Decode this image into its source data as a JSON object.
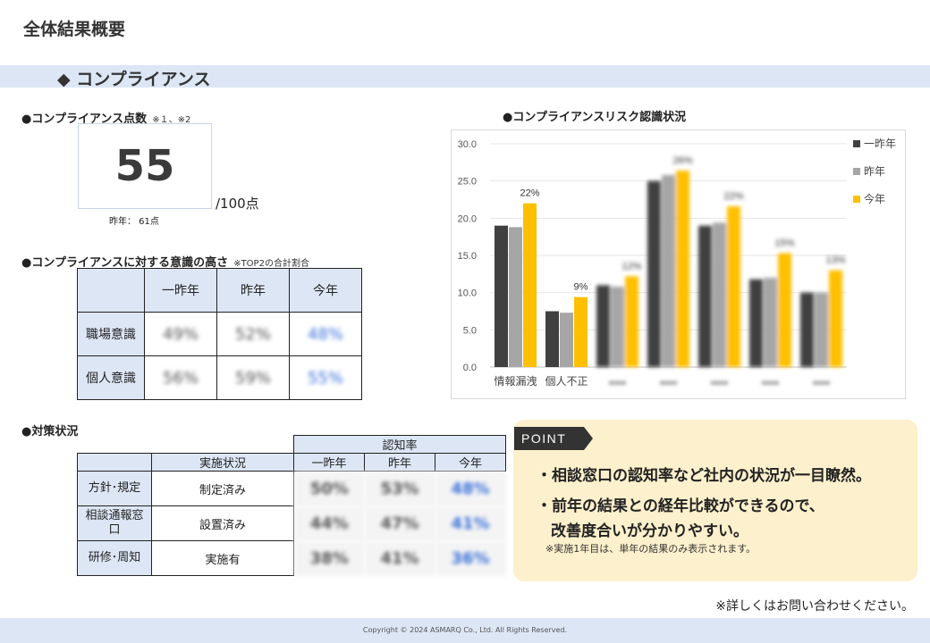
{
  "page": {
    "title": "全体結果概要",
    "section_title": "◆  コンプライアンス"
  },
  "score": {
    "heading": "●コンプライアンス点数",
    "note": "※１、※2",
    "value": "55",
    "unit": "/100点",
    "previous": "昨年：  61点"
  },
  "awareness": {
    "heading": "●コンプライアンスに対する意識の高さ",
    "note": "※TOP2の合計割合",
    "columns": [
      "一昨年",
      "昨年",
      "今年"
    ],
    "rows": [
      {
        "label": "職場意識",
        "values": [
          "49%",
          "52%",
          "48%"
        ]
      },
      {
        "label": "個人意識",
        "values": [
          "56%",
          "59%",
          "55%"
        ]
      }
    ]
  },
  "measures": {
    "heading": "●対策状況",
    "recognition_header": "認知率",
    "status_header": "実施状況",
    "columns": [
      "一昨年",
      "昨年",
      "今年"
    ],
    "rows": [
      {
        "label": "方針･規定",
        "status": "制定済み",
        "values": [
          "50%",
          "53%",
          "48%"
        ]
      },
      {
        "label": "相談通報窓口",
        "status": "設置済み",
        "values": [
          "44%",
          "47%",
          "41%"
        ]
      },
      {
        "label": "研修･周知",
        "status": "実施有",
        "values": [
          "38%",
          "41%",
          "36%"
        ]
      }
    ]
  },
  "chart_data": {
    "title": "●コンプライアンスリスク認識状況",
    "type": "bar",
    "ylim": [
      0,
      30
    ],
    "yticks": [
      "0.0",
      "5.0",
      "10.0",
      "15.0",
      "20.0",
      "25.0",
      "30.0"
    ],
    "categories": [
      "情報漏洩",
      "個人不正",
      "",
      "",
      "",
      "",
      ""
    ],
    "series": [
      {
        "name": "一昨年",
        "color": "#404040",
        "values": [
          19,
          7.5,
          11,
          25,
          19,
          11.8,
          10
        ]
      },
      {
        "name": "昨年",
        "color": "#a6a6a6",
        "values": [
          18.8,
          7.3,
          10.8,
          25.8,
          19.4,
          12,
          10
        ]
      },
      {
        "name": "今年",
        "color": "#ffc000",
        "values": [
          22,
          9.4,
          12.2,
          26.4,
          21.6,
          15.3,
          13
        ]
      }
    ],
    "data_labels": [
      "22%",
      "9%",
      "12%",
      "26%",
      "22%",
      "15%",
      "13%"
    ],
    "blurred_from_index": 2,
    "legend_position": "right"
  },
  "point": {
    "tag": "POINT",
    "line1": "・相談窓口の認知率など社内の状況が一目瞭然。",
    "line2": "・前年の結果との経年比較ができるので、",
    "line3": "改善度合いが分かりやすい。",
    "note": "※実施1年目は、単年の結果のみ表示されます。"
  },
  "footer": {
    "contact": "※詳しくはお問い合わせください。",
    "copyright": "Copyright © 2024 ASMARQ Co., Ltd. All Rights Reserved."
  }
}
